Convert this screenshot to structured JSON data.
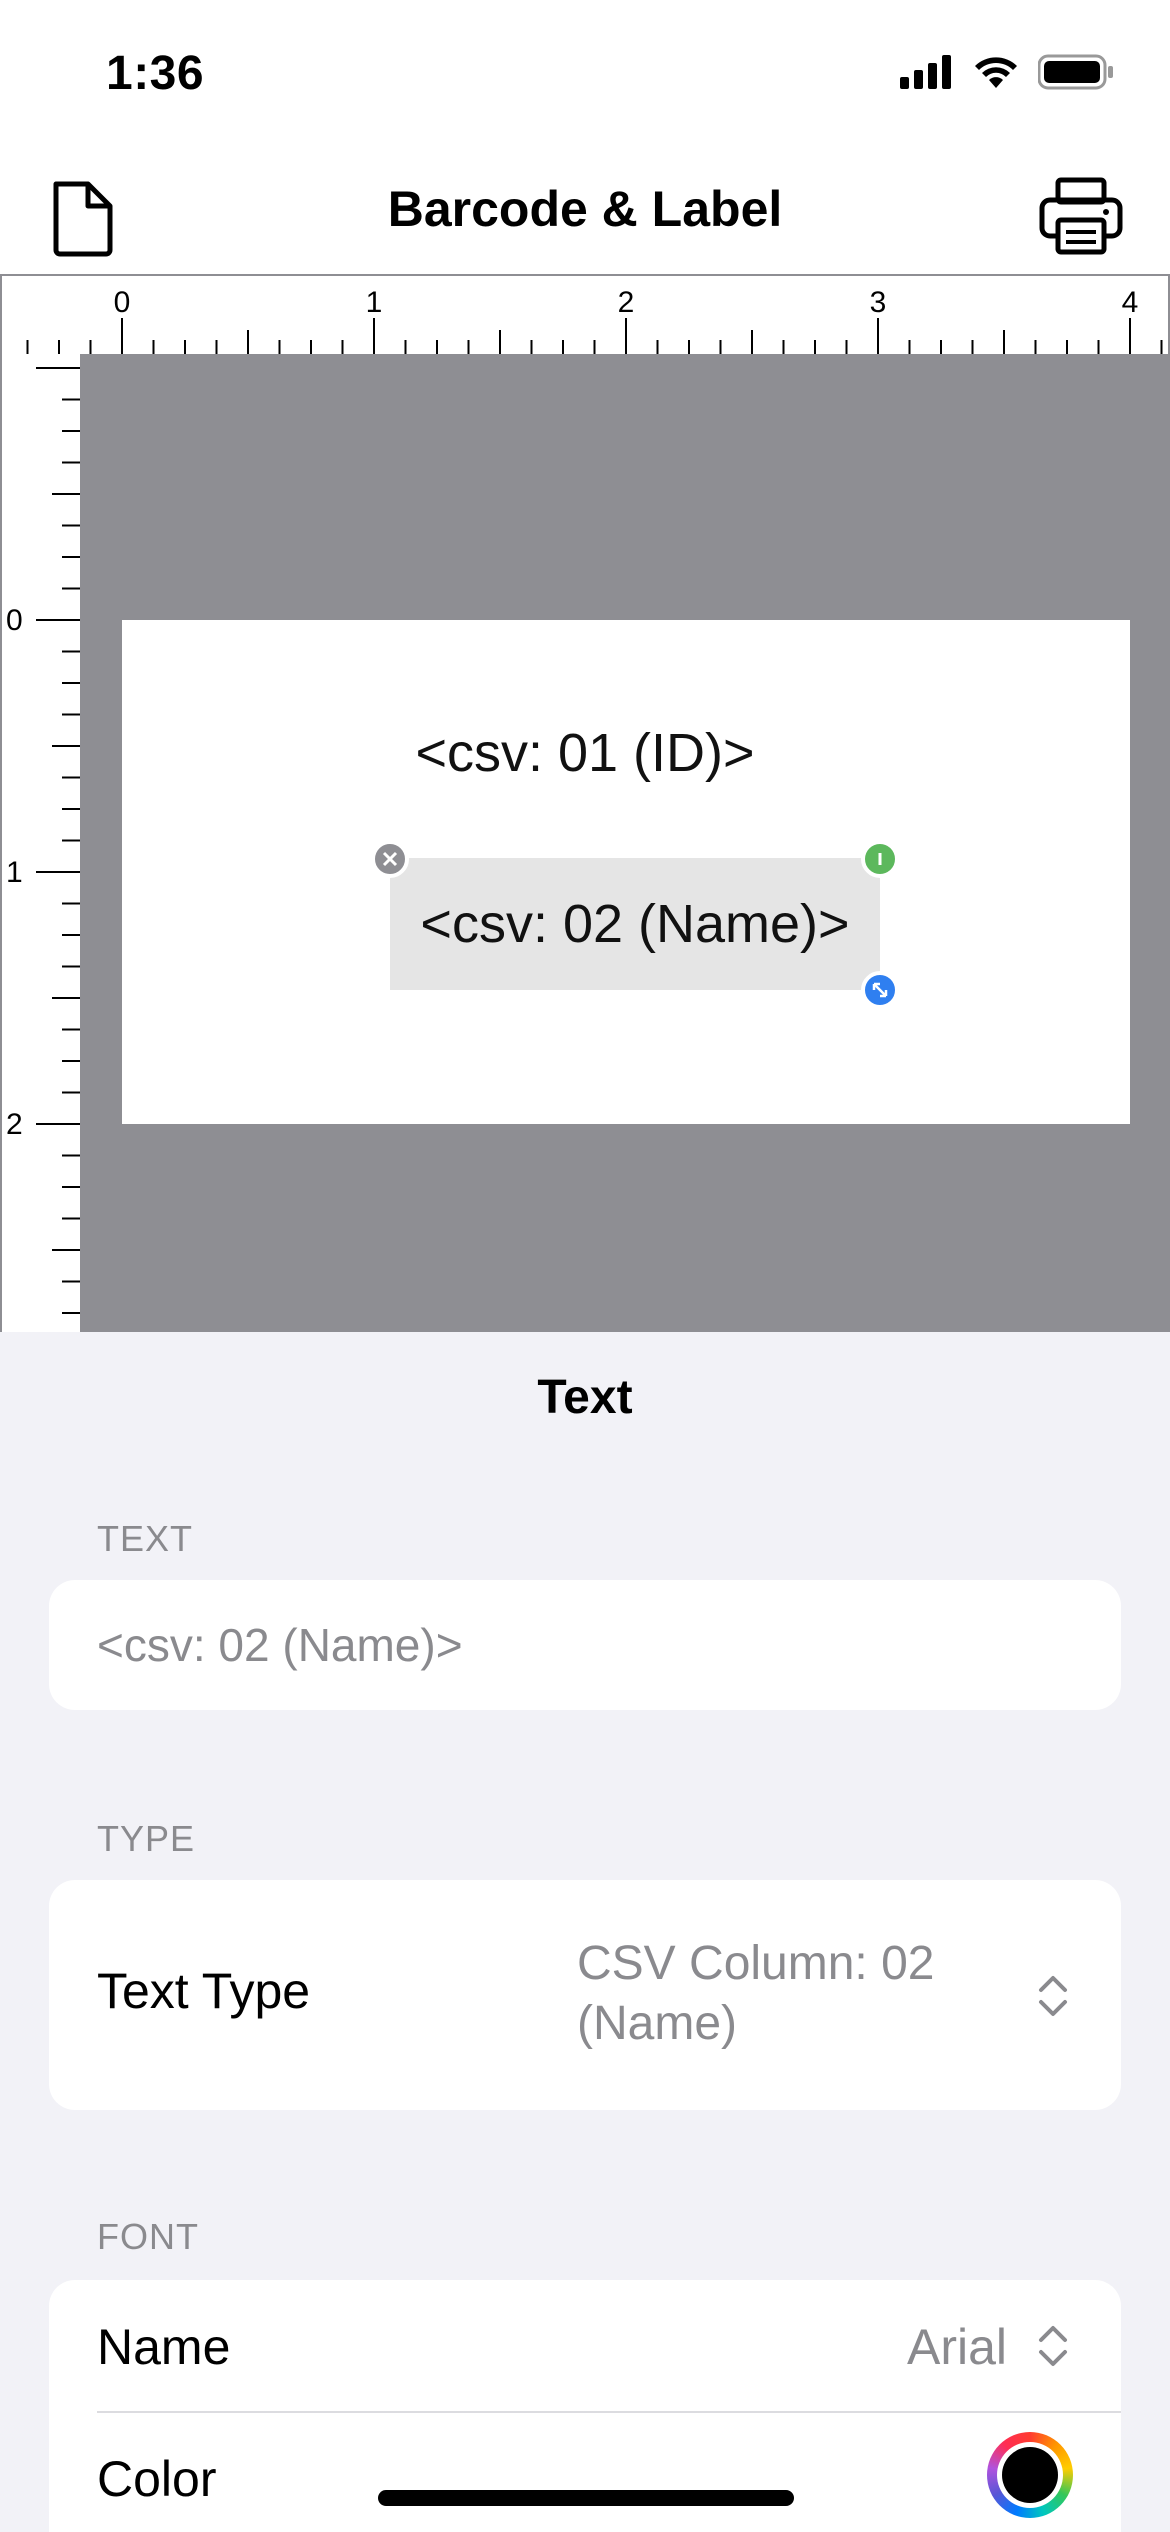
{
  "status_bar": {
    "time": "1:36"
  },
  "nav": {
    "title": "Barcode & Label",
    "left_icon": "document-icon",
    "right_icon": "printer-icon"
  },
  "ruler": {
    "top_labels": [
      "0",
      "1",
      "2",
      "3",
      "4"
    ],
    "left_labels": [
      "0",
      "1",
      "2"
    ]
  },
  "canvas": {
    "label_items": [
      {
        "text": "<csv: 01 (ID)>"
      },
      {
        "text": "<csv: 02 (Name)>",
        "selected": true
      }
    ],
    "colors": {
      "canvas_bg": "#8e8e93",
      "selection_bg": "#e5e5e5",
      "info_handle": "#5cb85c",
      "resize_handle": "#2f7ff0"
    }
  },
  "sheet": {
    "title": "Text",
    "text_section": {
      "header": "TEXT",
      "placeholder": "<csv: 02 (Name)>"
    },
    "type_section": {
      "header": "TYPE",
      "label": "Text Type",
      "value": "CSV Column: 02 (Name)"
    },
    "font_section": {
      "header": "FONT",
      "name_label": "Name",
      "name_value": "Arial",
      "color_label": "Color",
      "color_value": "#000000"
    }
  }
}
